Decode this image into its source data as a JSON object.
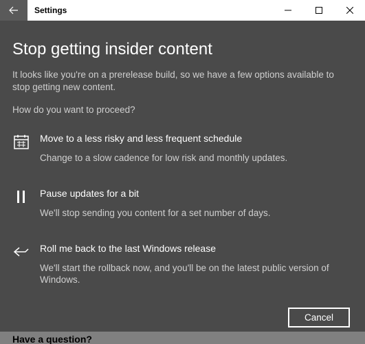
{
  "window": {
    "title": "Settings"
  },
  "page": {
    "heading": "Stop getting insider content",
    "intro": "It looks like you're on a prerelease build, so we have a few options available to stop getting new content.",
    "prompt": "How do you want to proceed?"
  },
  "options": [
    {
      "icon": "calendar-icon",
      "title": "Move to a less risky and less frequent schedule",
      "desc": "Change to a slow cadence for low risk and monthly updates."
    },
    {
      "icon": "pause-icon",
      "title": "Pause updates for a bit",
      "desc": "We'll stop sending you content for a set number of days."
    },
    {
      "icon": "rollback-icon",
      "title": "Roll me back to the last Windows release",
      "desc": "We'll start the rollback now, and you'll be on the latest public version of Windows."
    }
  ],
  "buttons": {
    "cancel": "Cancel"
  },
  "footer": {
    "hint": "Have a question?"
  }
}
